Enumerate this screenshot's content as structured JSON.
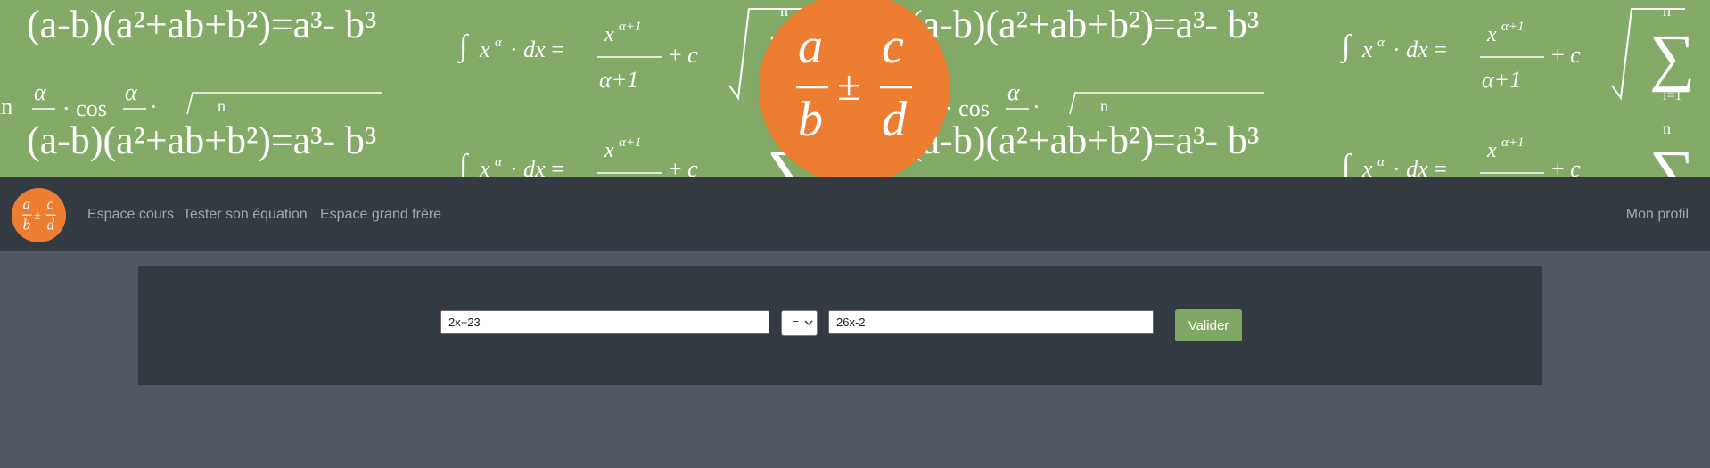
{
  "brand": {
    "logo_icon": "fraction-plus-minus-logo-icon",
    "logo_color": "#ed7d31",
    "logo_text": "a/b ± c/d"
  },
  "banner": {
    "background_color": "#83aa66",
    "pattern_icon": "math-formulas-pattern"
  },
  "navbar": {
    "background_color": "#343a42",
    "links": [
      {
        "label": "Espace cours"
      },
      {
        "label": "Tester son équation"
      },
      {
        "label": "Espace grand frère"
      }
    ],
    "profile_label": "Mon profil"
  },
  "equation_form": {
    "left_value": "2x+23",
    "operator_value": "=",
    "right_value": "26x-2",
    "submit_label": "Valider",
    "submit_color": "#7fa864"
  }
}
